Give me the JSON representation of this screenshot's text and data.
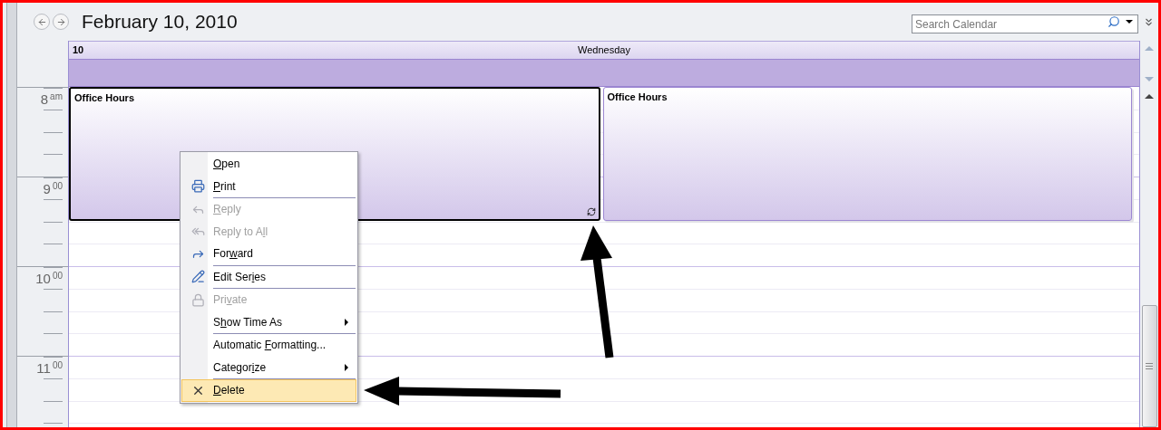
{
  "header": {
    "title": "February 10, 2010",
    "search": {
      "placeholder": "Search Calendar"
    }
  },
  "day": {
    "number": "10",
    "weekday": "Wednesday"
  },
  "hours": [
    {
      "hour": "8",
      "suffix": "am"
    },
    {
      "hour": "9",
      "suffix": "00"
    },
    {
      "hour": "10",
      "suffix": "00"
    },
    {
      "hour": "11",
      "suffix": "00"
    }
  ],
  "appointments": [
    {
      "title": "Office Hours",
      "selected": true,
      "recurring": true
    },
    {
      "title": "Office Hours",
      "selected": false,
      "recurring": false
    }
  ],
  "context_menu": [
    {
      "kind": "open",
      "key": "O",
      "after": "pen",
      "disabled": false,
      "separator_before": false,
      "submenu": false,
      "selected": false
    },
    {
      "kind": "print",
      "key": "P",
      "after": "rint",
      "disabled": false,
      "separator_before": false,
      "submenu": false,
      "selected": false
    },
    {
      "kind": "reply",
      "key": "R",
      "after": "eply",
      "disabled": true,
      "separator_before": true,
      "submenu": false,
      "selected": false
    },
    {
      "kind": "reply_all",
      "before": "Reply to A",
      "key": "l",
      "after": "l",
      "disabled": true,
      "separator_before": false,
      "submenu": false,
      "selected": false
    },
    {
      "kind": "forward",
      "before": "For",
      "key": "w",
      "after": "ard",
      "disabled": false,
      "separator_before": false,
      "submenu": false,
      "selected": false
    },
    {
      "kind": "edit_series",
      "before": "Edit Ser",
      "key": "i",
      "after": "es",
      "disabled": false,
      "separator_before": true,
      "submenu": false,
      "selected": false
    },
    {
      "kind": "private",
      "before": "Pri",
      "key": "v",
      "after": "ate",
      "disabled": true,
      "separator_before": true,
      "submenu": false,
      "selected": false
    },
    {
      "kind": "show_time_as",
      "before": "S",
      "key": "h",
      "after": "ow Time As",
      "disabled": false,
      "separator_before": false,
      "submenu": true,
      "selected": false
    },
    {
      "kind": "formatting",
      "before": "Automatic ",
      "key": "F",
      "after": "ormatting...",
      "disabled": false,
      "separator_before": true,
      "submenu": false,
      "selected": false
    },
    {
      "kind": "categorize",
      "before": "Categor",
      "key": "i",
      "after": "ze",
      "disabled": false,
      "separator_before": false,
      "submenu": true,
      "selected": false
    },
    {
      "kind": "delete",
      "key": "D",
      "after": "elete",
      "disabled": false,
      "separator_before": true,
      "submenu": false,
      "selected": true
    }
  ]
}
